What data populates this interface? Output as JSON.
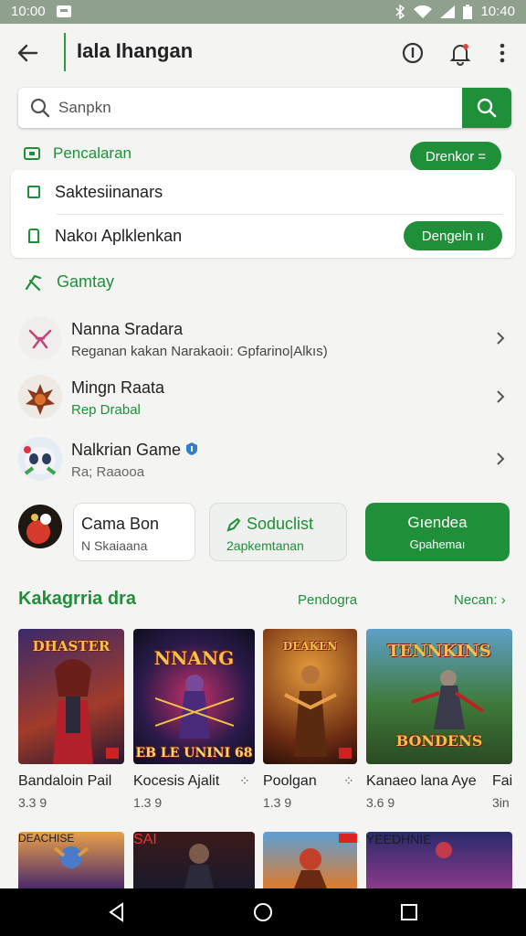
{
  "status": {
    "time": "10:00",
    "right_time": "10:40"
  },
  "appbar": {
    "title": "Iala Ihangan"
  },
  "search": {
    "placeholder": "Sanpkn"
  },
  "section1": {
    "label": "Pencalaran",
    "button": "Drenkor ="
  },
  "card1": {
    "row1": "Saktesiinanars",
    "row2": "Nakoı Aplklenkan",
    "row2_button": "Dengeln ıı"
  },
  "gameplay": {
    "label": "Gamtay"
  },
  "items": [
    {
      "title": "Nanna Sradara",
      "subtitle": "Reganan kakan Narakaoiı: Gpfarino|Alkıs)"
    },
    {
      "title": "Mingn Raata",
      "subtitle": "Rep Drabal"
    },
    {
      "title": "Nalkrian Game",
      "subtitle": "Ra; Raaooa"
    }
  ],
  "chips": [
    {
      "title": "Cama Bon",
      "subtitle": "N Skaiaana"
    },
    {
      "title": "Soduclist",
      "subtitle": "2apkemtanan"
    },
    {
      "title": "Gıendea",
      "subtitle": "Gpahemaı"
    }
  ],
  "kategori": {
    "title": "Kakagrria dra",
    "link1": "Pendogra",
    "link2": "Necan: ›"
  },
  "games": [
    {
      "name": "Bandaloin  Pail",
      "rating": "3.3 9",
      "banner": "DHASTER"
    },
    {
      "name": "Kocesis Ajalit",
      "rating": "1.3 9",
      "banner": "NNANG",
      "banner2": "EB LE UNINI 68"
    },
    {
      "name": "Poolgan",
      "rating": "1.3 9",
      "banner": "DEAKEN"
    },
    {
      "name": "Kanaeo lana Aye",
      "rating": "3.6 9",
      "banner": "TENNKINS",
      "banner2": "BONDENS"
    },
    {
      "name": "Fai",
      "rating": "3in"
    }
  ],
  "row2_banners": [
    "DEACHISE",
    "SAI",
    "",
    "YEEDHNIE"
  ],
  "colors": {
    "accent": "#1f8f3a",
    "statusbar": "#8fa08f",
    "background": "#f4f5f3"
  }
}
